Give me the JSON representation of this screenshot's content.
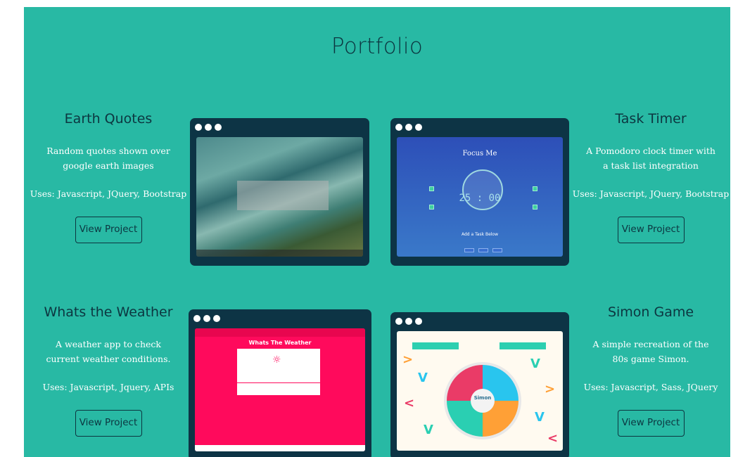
{
  "page": {
    "title": "Portfolio"
  },
  "projects": [
    {
      "name": "Earth Quotes",
      "blurb": "Random quotes shown over google earth images",
      "uses": "Uses: Javascript, JQuery, Bootstrap",
      "button": "View Project"
    },
    {
      "name": "Task Timer",
      "blurb": "A Pomodoro clock timer with a task list integration",
      "uses": "Uses: Javascript, JQuery, Bootstrap",
      "button": "View Project"
    },
    {
      "name": "Whats the Weather",
      "blurb": "A weather app to check current weather conditions.",
      "uses": "Uses: Javascript, Jquery, APIs",
      "button": "View Project"
    },
    {
      "name": "Simon Game",
      "blurb": "A simple recreation of the 80s game Simon.",
      "uses": "Uses: Javascript, Sass, JQuery",
      "button": "View Project"
    }
  ],
  "previews": {
    "task_timer": {
      "heading": "Focus Me",
      "clock": "25 : 00",
      "add_task": "Add a Task Below"
    },
    "weather": {
      "heading": "Whats The Weather"
    },
    "simon": {
      "label": "Simon"
    }
  },
  "colors": {
    "page_bg": "#28b9a4",
    "accent_dark": "#0c3640",
    "window_frame": "#0d3445",
    "weather_pink": "#ff0a5c"
  },
  "icons": {
    "window_dots": "three-dots-icon",
    "weather_sun": "sun-icon"
  }
}
